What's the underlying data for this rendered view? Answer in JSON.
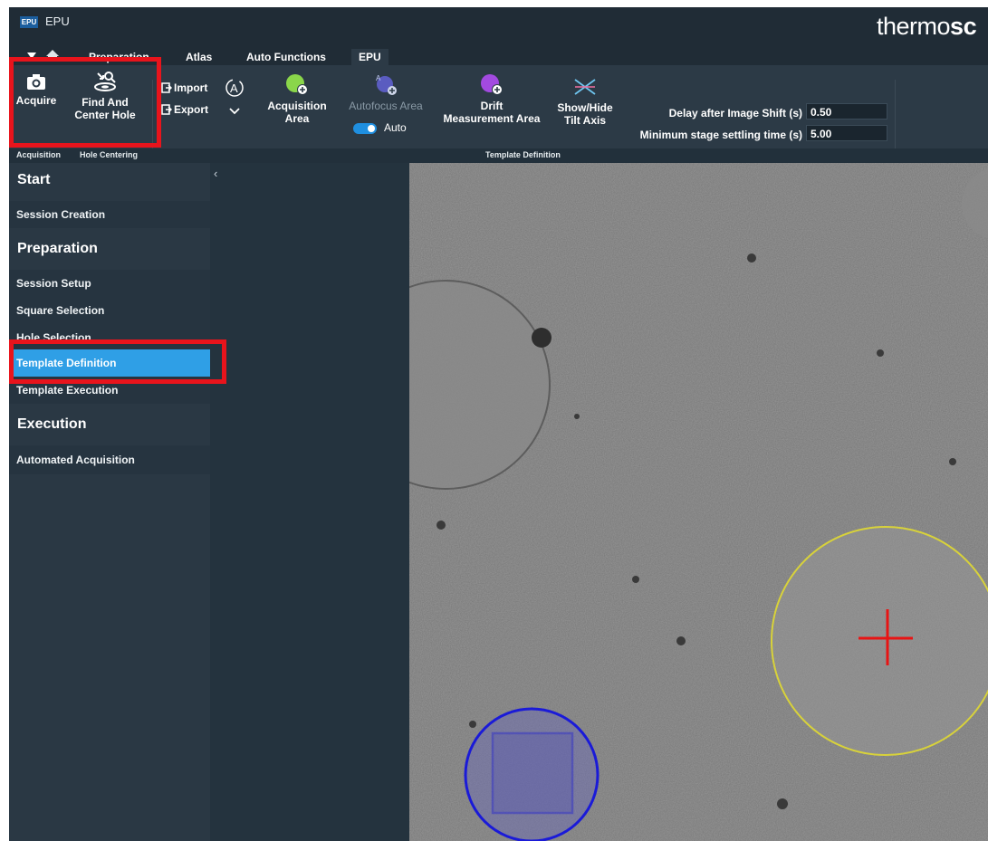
{
  "title_bar": {
    "badge": "EPU",
    "app_title": "EPU",
    "brand_light": "thermo",
    "brand_bold": "sc"
  },
  "menu": {
    "tabs": [
      "Preparation",
      "Atlas",
      "Auto Functions",
      "EPU"
    ],
    "active_tab": "EPU"
  },
  "ribbon": {
    "acquire_label": "Acquire",
    "find_center_label_1": "Find And",
    "find_center_label_2": "Center Hole",
    "import_label": "Import",
    "export_label": "Export",
    "acquisition_area_1": "Acquisition",
    "acquisition_area_2": "Area",
    "autofocus_area_label": "Autofocus Area",
    "auto_label": "Auto",
    "drift_1": "Drift",
    "drift_2": "Measurement Area",
    "showhide_1": "Show/Hide",
    "showhide_2": "Tilt Axis",
    "delay_label": "Delay after Image Shift (s)",
    "delay_value": "0.50",
    "settling_label": "Minimum stage settling time (s)",
    "settling_value": "5.00",
    "groups": {
      "acquisition": "Acquisition",
      "hole_centering": "Hole Centering",
      "template_definition": "Template Definition"
    }
  },
  "sidebar": {
    "sections": {
      "start": "Start",
      "preparation": "Preparation",
      "execution": "Execution"
    },
    "items": {
      "session_creation": "Session Creation",
      "session_setup": "Session Setup",
      "square_selection": "Square Selection",
      "hole_selection": "Hole Selection",
      "template_definition": "Template Definition",
      "template_execution": "Template Execution",
      "automated_acquisition": "Automated Acquisition"
    },
    "active_item": "Template Definition"
  },
  "colors": {
    "highlight_red": "#e8141c",
    "active_blue": "#2f9fe6",
    "acquisition_circle": "#1a1ad8",
    "autofocus_circle": "#d8d23a",
    "crosshair": "#e81414"
  }
}
